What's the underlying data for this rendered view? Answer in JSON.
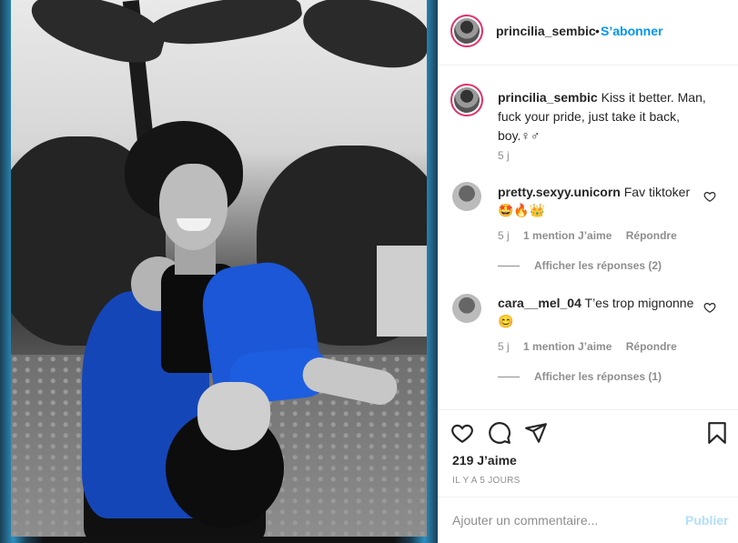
{
  "post": {
    "username": "princilia_sembic",
    "follow_label": "S’abonner",
    "separator": "•",
    "more_label": "···"
  },
  "caption": {
    "username": "princilia_sembic",
    "text": "Kiss it better. Man, fuck your pride, just take it back, boy.♀♂",
    "time": "5 j"
  },
  "comments": [
    {
      "username": "pretty.sexyy.unicorn",
      "text": "Fav tiktoker",
      "emoji": "🤩🔥👑",
      "time": "5 j",
      "likes": "1 mention J’aime",
      "reply_label": "Répondre",
      "view_replies": "Afficher les réponses (2)"
    },
    {
      "username": "cara__mel_04",
      "text": "T’es trop mignonne",
      "emoji": "😊",
      "time": "5 j",
      "likes": "1 mention J’aime",
      "reply_label": "Répondre",
      "view_replies": "Afficher les réponses (1)"
    }
  ],
  "stats": {
    "likes": "219 J’aime",
    "date": "IL Y A 5 JOURS"
  },
  "add_comment": {
    "placeholder": "Ajouter un commentaire...",
    "publish_label": "Publier"
  },
  "icons": {
    "like": "heart-icon",
    "comment": "comment-icon",
    "share": "paper-plane-icon",
    "save": "bookmark-icon",
    "comment_like": "small-heart-icon"
  },
  "colors": {
    "accent_blue": "#0095f6",
    "muted_text": "#8e8e8e",
    "publish_disabled": "#b2dffc",
    "jacket_blue": "#1b57d6"
  }
}
